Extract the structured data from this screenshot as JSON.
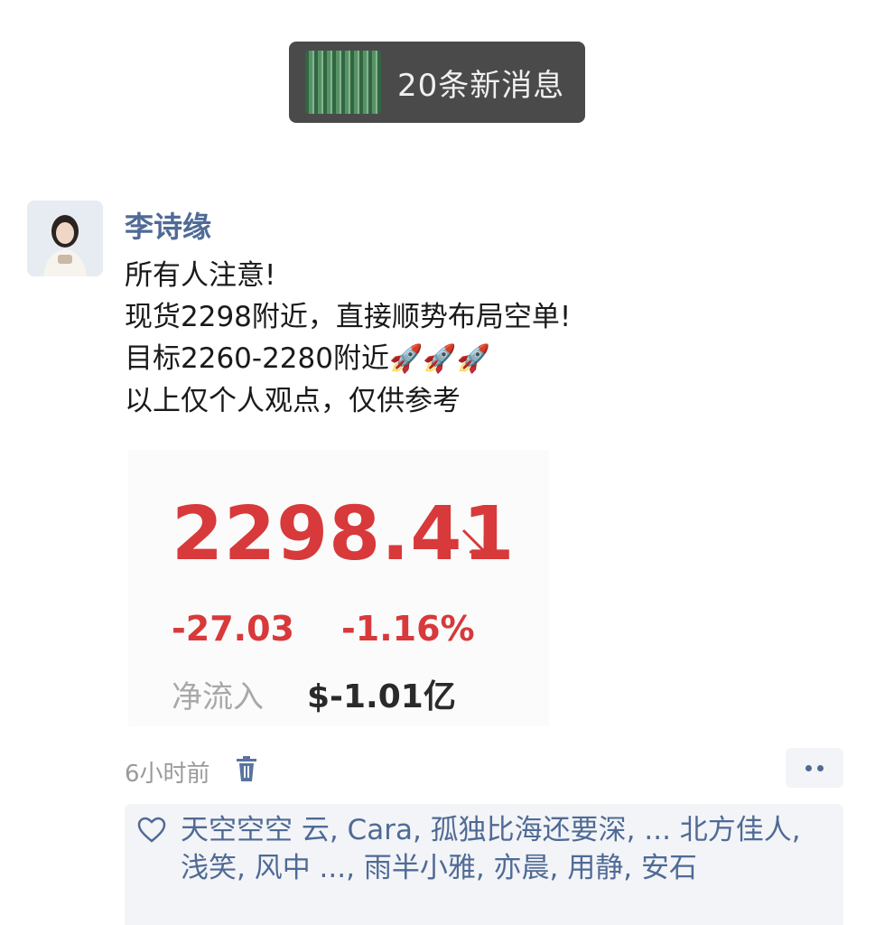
{
  "toast": {
    "text": "20条新消息"
  },
  "post": {
    "author": "李诗缘",
    "lines": [
      "所有人注意!",
      "现货2298附近，直接顺势布局空单!",
      "目标2260-2280附近",
      "以上仅个人观点，仅供参考"
    ],
    "rockets": "🚀🚀🚀"
  },
  "quote": {
    "price": "2298.41",
    "change": "-27.03",
    "percent": "-1.16%",
    "flow_label": "净流入",
    "flow_value": "$-1.01亿",
    "color": "#d8393a"
  },
  "meta": {
    "time": "6小时前",
    "icons": [
      "trash-icon",
      "more-icon",
      "heart-icon"
    ]
  },
  "likes": {
    "text": "天空空空 云, Cara, 孤独比海还要深, ... 北方佳人, 浅笑, 风中 ..., 雨半小雅, 亦晨, 用静, 安石"
  },
  "colors": {
    "name": "#4f6a96",
    "accent": "#d8393a",
    "muted": "#9a9a9a",
    "box_bg": "#f3f4f7"
  }
}
